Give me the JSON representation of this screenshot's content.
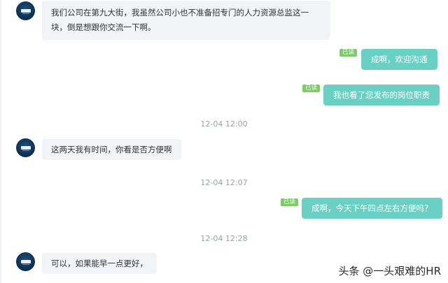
{
  "messages": {
    "m1": "我们公司在第九大街，我虽然公司小也不准备招专门的人力资源总监这一块，倒是想跟你交流一下啊。",
    "m2": "成啊，欢迎沟通",
    "m3": "我也看了您发布的岗位职责",
    "m4": "这两天我有时间，你看是否方便啊",
    "m5": "成啊，今天下午四点左右方便吗？",
    "m6": "可以，如果能早一点更好，"
  },
  "read_label": "已读",
  "timestamps": {
    "t1": "12-04 12:00",
    "t2": "12-04 12:07",
    "t3": "12-04 12:28"
  },
  "watermark": "头条 @一头艰难的HR"
}
